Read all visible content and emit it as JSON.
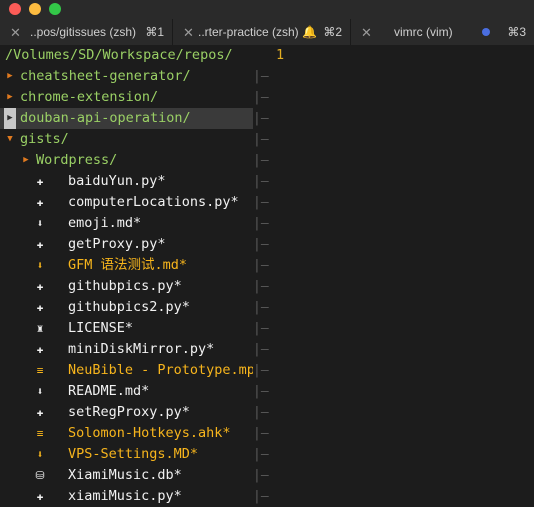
{
  "colors": {
    "close": "#fc5c57",
    "minimize": "#fdbc40",
    "zoom": "#33c748",
    "dir": "#9ad065",
    "file": "#f2f2f2",
    "modified": "#f7b51c",
    "line_number": "#e2ad22"
  },
  "tabs": [
    {
      "close": "✕",
      "title": "..pos/gitissues (zsh)",
      "shortcut": "⌘1"
    },
    {
      "close": "✕",
      "title": "..rter-practice (zsh)",
      "bell": "🔔",
      "shortcut": "⌘2"
    },
    {
      "close": "✕",
      "title": "vimrc (vim)",
      "dot": true,
      "shortcut": "⌘3"
    }
  ],
  "tree": {
    "root": "/Volumes/SD/Workspace/repos/",
    "items": [
      {
        "icon": "▶",
        "label": "cheatsheet-generator/",
        "type": "dir"
      },
      {
        "icon": "▶",
        "label": "chrome-extension/",
        "type": "dir"
      },
      {
        "icon": "▶",
        "label": "douban-api-operation/",
        "type": "dir",
        "selected": true
      },
      {
        "icon": "▼",
        "label": "gists/",
        "type": "dir"
      },
      {
        "icon": "▶",
        "label": "Wordpress/",
        "type": "dir",
        "indent": 1
      },
      {
        "icon": "python",
        "label": "baiduYun.py*",
        "type": "file",
        "indent": 2
      },
      {
        "icon": "python",
        "label": "computerLocations.py*",
        "type": "file",
        "indent": 2
      },
      {
        "icon": "markdown",
        "label": "emoji.md*",
        "type": "file",
        "indent": 2
      },
      {
        "icon": "python",
        "label": "getProxy.py*",
        "type": "file",
        "indent": 2
      },
      {
        "icon": "markdown",
        "label": "GFM 语法测试.md*",
        "type": "modified",
        "indent": 2
      },
      {
        "icon": "python",
        "label": "githubpics.py*",
        "type": "file",
        "indent": 2
      },
      {
        "icon": "python",
        "label": "githubpics2.py*",
        "type": "file",
        "indent": 2
      },
      {
        "icon": "license",
        "label": "LICENSE*",
        "type": "file",
        "indent": 2
      },
      {
        "icon": "python",
        "label": "miniDiskMirror.py*",
        "type": "file",
        "indent": 2
      },
      {
        "icon": "text",
        "label": "NeuBible - Prototype.mp",
        "type": "modified",
        "indent": 2
      },
      {
        "icon": "markdown",
        "label": "README.md*",
        "type": "file",
        "indent": 2
      },
      {
        "icon": "python",
        "label": "setRegProxy.py*",
        "type": "file",
        "indent": 2
      },
      {
        "icon": "text",
        "label": "Solomon-Hotkeys.ahk*",
        "type": "modified",
        "indent": 2
      },
      {
        "icon": "markdown",
        "label": "VPS-Settings.MD*",
        "type": "modified",
        "indent": 2
      },
      {
        "icon": "db",
        "label": "XiamiMusic.db*",
        "type": "file",
        "indent": 2
      },
      {
        "icon": "python",
        "label": "xiamiMusic.py*",
        "type": "file",
        "indent": 2
      }
    ]
  },
  "editor": {
    "line_number": "1",
    "gutter_mark": "|–"
  }
}
